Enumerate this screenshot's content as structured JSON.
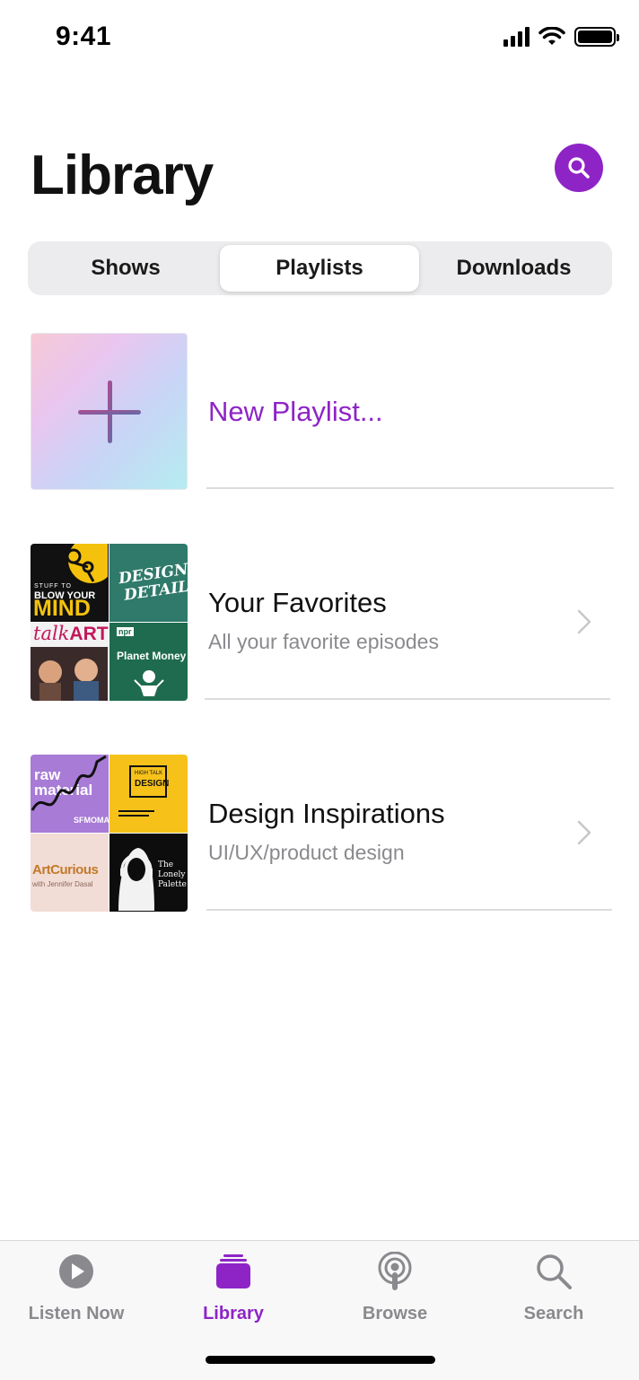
{
  "status_bar": {
    "time": "9:41"
  },
  "header": {
    "title": "Library"
  },
  "segments": {
    "shows": "Shows",
    "playlists": "Playlists",
    "downloads": "Downloads",
    "selected": "Playlists"
  },
  "new_playlist": {
    "label": "New Playlist..."
  },
  "playlists": [
    {
      "title": "Your Favorites",
      "subtitle": "All your favorite episodes",
      "artwork": {
        "tile1": {
          "line1": "STUFF TO",
          "line2": "BLOW YOUR",
          "line3": "MIND"
        },
        "tile2": {
          "line1": "DESIGN",
          "line2": "DETAILS"
        },
        "tile3": {
          "text_a": "talk",
          "text_b": "ART"
        },
        "tile4": {
          "badge": "npr",
          "name": "Planet Money"
        }
      }
    },
    {
      "title": "Design Inspirations",
      "subtitle": "UI/UX/product design",
      "artwork": {
        "tile1": {
          "line1": "raw",
          "line2": "material",
          "brand_a": "SF",
          "brand_b": "MO",
          "brand_c": "MA"
        },
        "tile2": {
          "line1": "HIGH TALK",
          "line2": "DESIGN"
        },
        "tile3": {
          "name": "ArtCurious",
          "host": "with Jennifer Dasal"
        },
        "tile4": {
          "line1": "The",
          "line2": "Lonely",
          "line3": "Palette"
        }
      }
    }
  ],
  "tabs": [
    {
      "label": "Listen Now",
      "icon": "play-circle-icon",
      "active": false
    },
    {
      "label": "Library",
      "icon": "library-stack-icon",
      "active": true
    },
    {
      "label": "Browse",
      "icon": "podcast-icon",
      "active": false
    },
    {
      "label": "Search",
      "icon": "magnifier-icon",
      "active": false
    }
  ],
  "colors": {
    "accent": "#8e24c6",
    "secondary_text": "#8a8a8e",
    "segment_bg": "#ececee"
  }
}
